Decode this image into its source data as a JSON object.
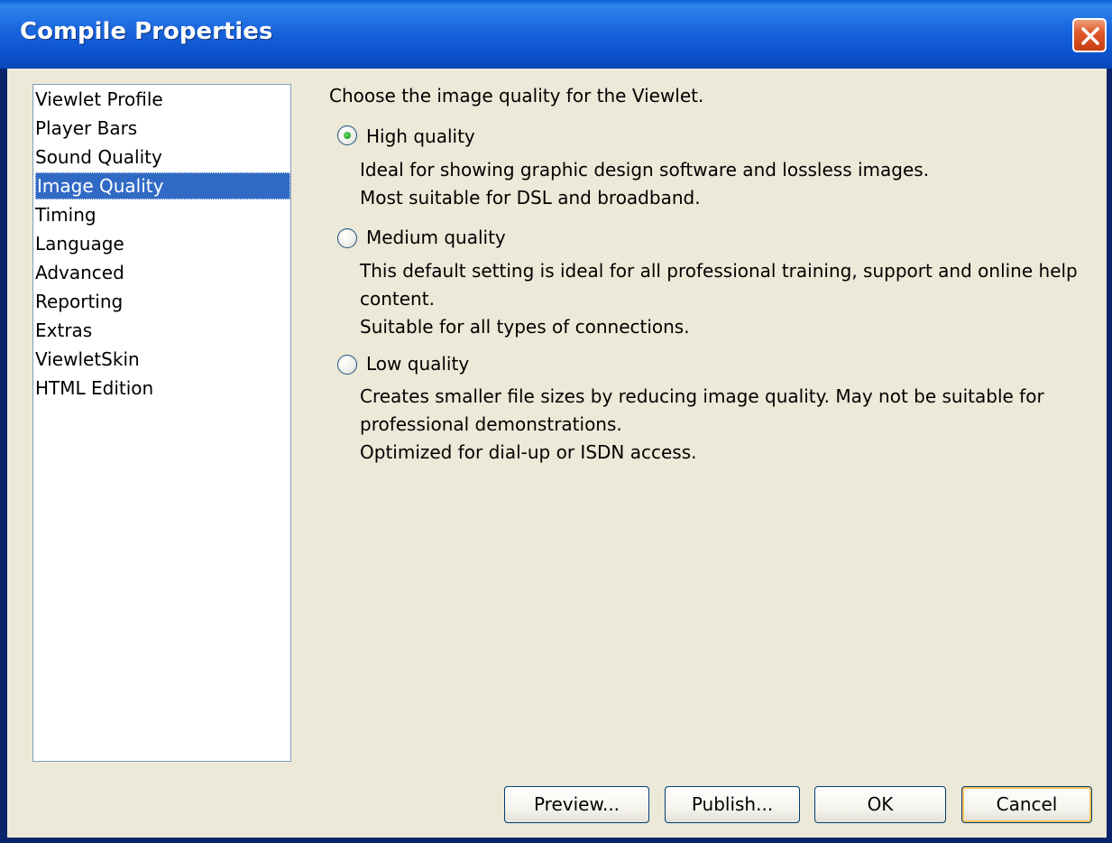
{
  "window": {
    "title": "Compile Properties"
  },
  "nav": {
    "items": [
      {
        "label": "Viewlet Profile"
      },
      {
        "label": "Player Bars"
      },
      {
        "label": "Sound Quality"
      },
      {
        "label": "Image Quality",
        "selected": true
      },
      {
        "label": "Timing"
      },
      {
        "label": "Language"
      },
      {
        "label": "Advanced"
      },
      {
        "label": "Reporting"
      },
      {
        "label": "Extras"
      },
      {
        "label": "ViewletSkin"
      },
      {
        "label": "HTML Edition"
      }
    ]
  },
  "main": {
    "heading": "Choose the image quality for the Viewlet.",
    "options": [
      {
        "label": "High quality",
        "checked": true,
        "desc": [
          "Ideal for showing graphic design software and lossless images.",
          "Most suitable for DSL and broadband."
        ]
      },
      {
        "label": "Medium quality",
        "checked": false,
        "desc": [
          "This default setting is ideal for all professional training, support and online help",
          "content.",
          "Suitable for all types of connections."
        ]
      },
      {
        "label": "Low quality",
        "checked": false,
        "desc": [
          "Creates smaller file sizes by reducing image quality. May not be suitable for",
          "professional demonstrations.",
          "Optimized for dial-up or ISDN access."
        ]
      }
    ]
  },
  "buttons": {
    "preview": "Preview...",
    "publish": "Publish...",
    "ok": "OK",
    "cancel": "Cancel"
  },
  "colors": {
    "title_bar": "#0b4fc9",
    "selection": "#316ac5",
    "dialog_bg": "#ece9d8",
    "close_button": "#e05a2a"
  }
}
